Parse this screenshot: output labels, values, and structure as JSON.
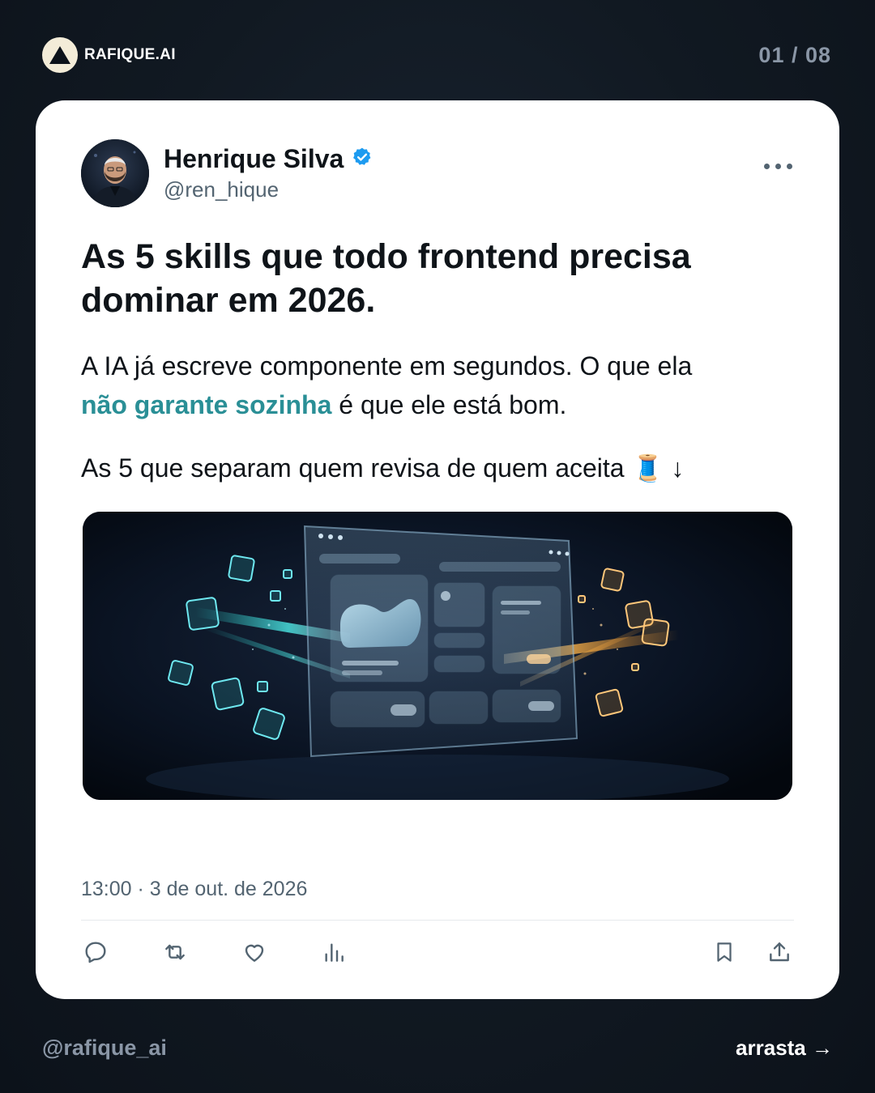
{
  "brand": {
    "name": "RAFIQUE.AI",
    "icon": "triangle-logo-icon"
  },
  "pagination": {
    "label": "01 / 08"
  },
  "tweet": {
    "author": {
      "name": "Henrique Silva",
      "handle": "@ren_hique",
      "verified": true,
      "avatar": "profile-photo"
    },
    "headline_line1": "As 5 skills que todo frontend precisa",
    "headline_line2": "dominar em 2026.",
    "paragraph1_start": "A IA já escreve componente em segundos. O que ela",
    "paragraph1_highlight": "não garante sozinha",
    "paragraph1_end": " é que ele está bom.",
    "paragraph2_text": "As 5 que separam quem revisa de quem aceita",
    "paragraph2_emoji": "🧵",
    "paragraph2_arrow": " ↓",
    "timestamp": "13:00 · 3 de out. de 2026",
    "actions": [
      "reply-icon",
      "retweet-icon",
      "like-icon",
      "views-icon",
      "bookmark-icon",
      "share-icon"
    ]
  },
  "footer": {
    "handle": "@rafique_ai",
    "cta": "arrasta →"
  },
  "colors": {
    "highlight": "#2a8f96",
    "verified": "#1d9bf0",
    "background": "#111922",
    "card": "#ffffff"
  }
}
